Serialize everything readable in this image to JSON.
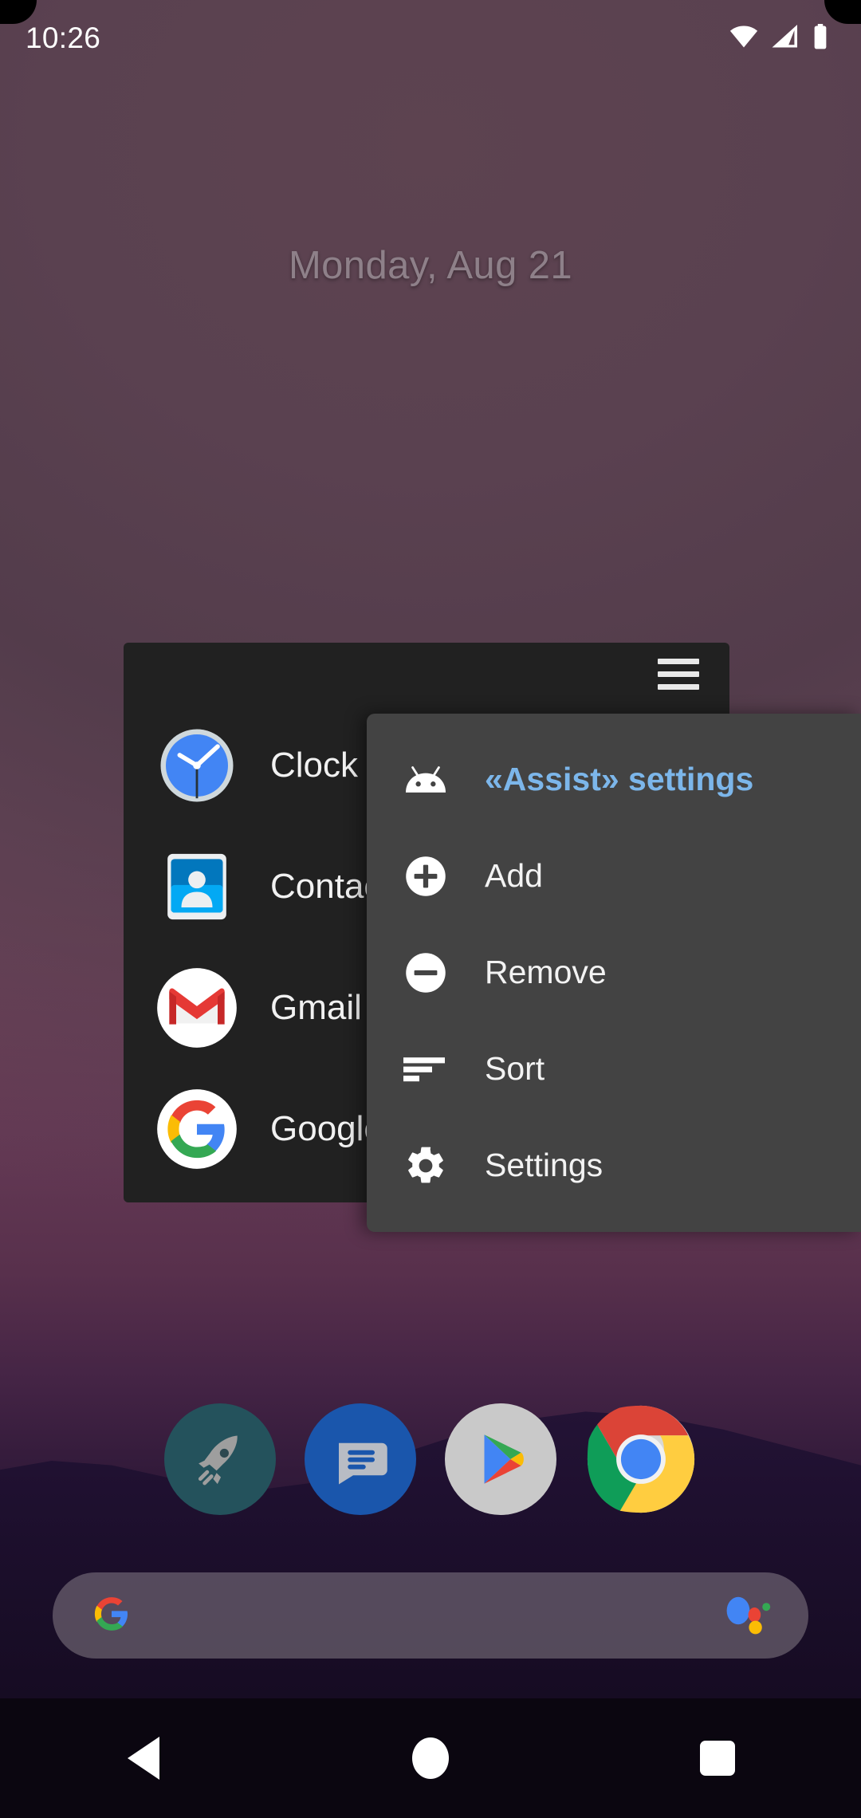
{
  "statusbar": {
    "time": "10:26",
    "icons": [
      {
        "name": "wifi-icon",
        "label": "wifi"
      },
      {
        "name": "cellular-signal-icon",
        "label": "signal"
      },
      {
        "name": "battery-icon",
        "label": "battery"
      }
    ]
  },
  "home": {
    "date_widget": "Monday, Aug 21"
  },
  "app_list": {
    "menu_button_label": "menu",
    "apps": [
      {
        "name": "Clock",
        "icon": "clock-icon"
      },
      {
        "name": "Contacts",
        "icon": "contacts-icon"
      },
      {
        "name": "Gmail",
        "icon": "gmail-icon"
      },
      {
        "name": "Google",
        "icon": "google-icon"
      }
    ]
  },
  "popup_menu": {
    "items": [
      {
        "label": "«Assist» settings",
        "icon": "android-robot-icon",
        "accent": true
      },
      {
        "label": "Add",
        "icon": "add-circle-icon",
        "accent": false
      },
      {
        "label": "Remove",
        "icon": "remove-circle-icon",
        "accent": false
      },
      {
        "label": "Sort",
        "icon": "sort-icon",
        "accent": false
      },
      {
        "label": "Settings",
        "icon": "gear-icon",
        "accent": false
      }
    ],
    "accent_color": "#7cb6ea",
    "background_color": "#434343"
  },
  "dock": {
    "items": [
      {
        "name": "Rocket",
        "icon": "rocket-icon"
      },
      {
        "name": "Messages",
        "icon": "messages-icon"
      },
      {
        "name": "Play Store",
        "icon": "play-store-icon"
      },
      {
        "name": "Chrome",
        "icon": "chrome-icon"
      }
    ]
  },
  "search_bar": {
    "placeholder": "",
    "value": "",
    "left_icon": "google-g-icon",
    "right_icon": "google-assistant-icon"
  },
  "nav_bar": {
    "back_label": "Back",
    "home_label": "Home",
    "recents_label": "Recents"
  }
}
